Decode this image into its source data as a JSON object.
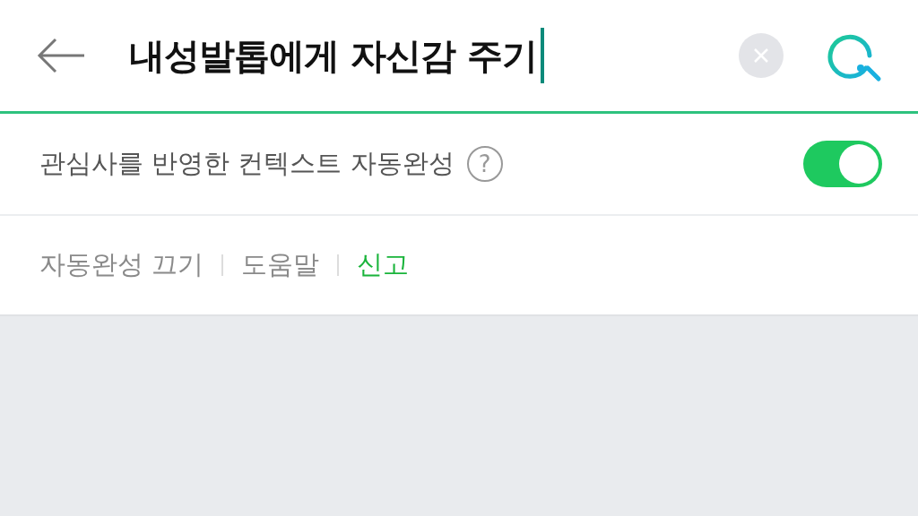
{
  "search": {
    "value": "내성발톱에게 자신감 주기"
  },
  "context_autocomplete": {
    "label": "관심사를 반영한 컨텍스트 자동완성",
    "help": "?",
    "on": true
  },
  "links": [
    {
      "label": "자동완성 끄기",
      "color": "#8a8a8a"
    },
    {
      "label": "도움말",
      "color": "#8a8a8a"
    },
    {
      "label": "신고",
      "color": "#1ab43b"
    }
  ]
}
